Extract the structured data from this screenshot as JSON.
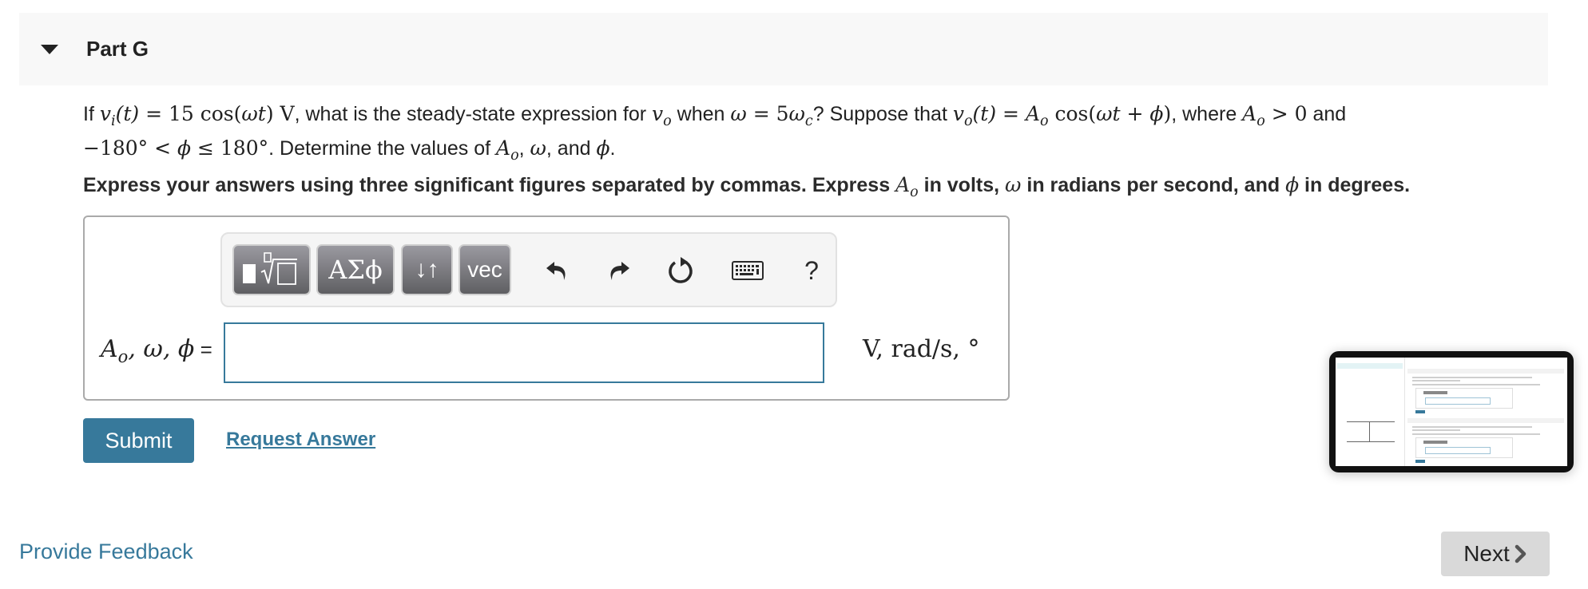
{
  "part": {
    "title": "Part G",
    "expanded": true,
    "caret_icon": "caret-down-icon"
  },
  "question": {
    "line1": {
      "t1": "If ",
      "m1": "v",
      "m1_sub": "i",
      "m1b": "(t)",
      "m1c": " = 15 cos(",
      "m1d": "ωt",
      "m1e": ") V",
      "t2": ", what is the steady-state expression for ",
      "m2": "v",
      "m2_sub": "o",
      "t3": " when ",
      "m3": "ω",
      "m3b": " = 5",
      "m3c": "ω",
      "m3_sub": "c",
      "t4": "? Suppose that ",
      "m4": "v",
      "m4_sub": "o",
      "m4b": "(t)",
      "m4c": " = ",
      "m4d": "A",
      "m4d_sub": "o",
      "m4e": " cos(",
      "m4f": "ωt",
      "m4g": " + ",
      "m4h": "ϕ",
      "m4i": ")",
      "t5": ", where ",
      "m5": "A",
      "m5_sub": "o",
      "m5b": " > 0",
      "t6": " and"
    },
    "line2": {
      "m1": "−180° < ",
      "m2": "ϕ",
      "m3": " ≤ 180°",
      "t1": ". Determine the values of ",
      "m4": "A",
      "m4_sub": "o",
      "t2": ", ",
      "m5": "ω",
      "t3": ", and ",
      "m6": "ϕ",
      "t4": "."
    }
  },
  "instructions": {
    "t1": "Express your answers using three significant figures separated by commas. Express ",
    "m1": "A",
    "m1_sub": "o",
    "t2": " in volts, ",
    "m2": "ω",
    "t3": " in radians per second, and ",
    "m3": "ϕ",
    "t4": " in degrees."
  },
  "toolbar": {
    "templates_label": "templates",
    "greek_label": "ΑΣϕ",
    "arrows_label": "↓↑",
    "vec_label": "vec",
    "undo_icon": "undo-icon",
    "redo_icon": "redo-icon",
    "reset_icon": "reset-icon",
    "keyboard_icon": "keyboard-icon",
    "help_label": "?"
  },
  "answer": {
    "label_A": "A",
    "label_A_sub": "o",
    "label_rest": ", ω, ϕ",
    "label_eq": " =",
    "value": "",
    "placeholder": "",
    "units": "V, rad/s, °"
  },
  "actions": {
    "submit_label": "Submit",
    "request_answer_label": "Request Answer"
  },
  "footer": {
    "feedback_label": "Provide Feedback",
    "next_label": "Next",
    "next_icon": "chevron-right-icon"
  },
  "colors": {
    "accent": "#37799b",
    "header_bg": "#f8f8f8",
    "next_bg": "#d9d9d9"
  }
}
